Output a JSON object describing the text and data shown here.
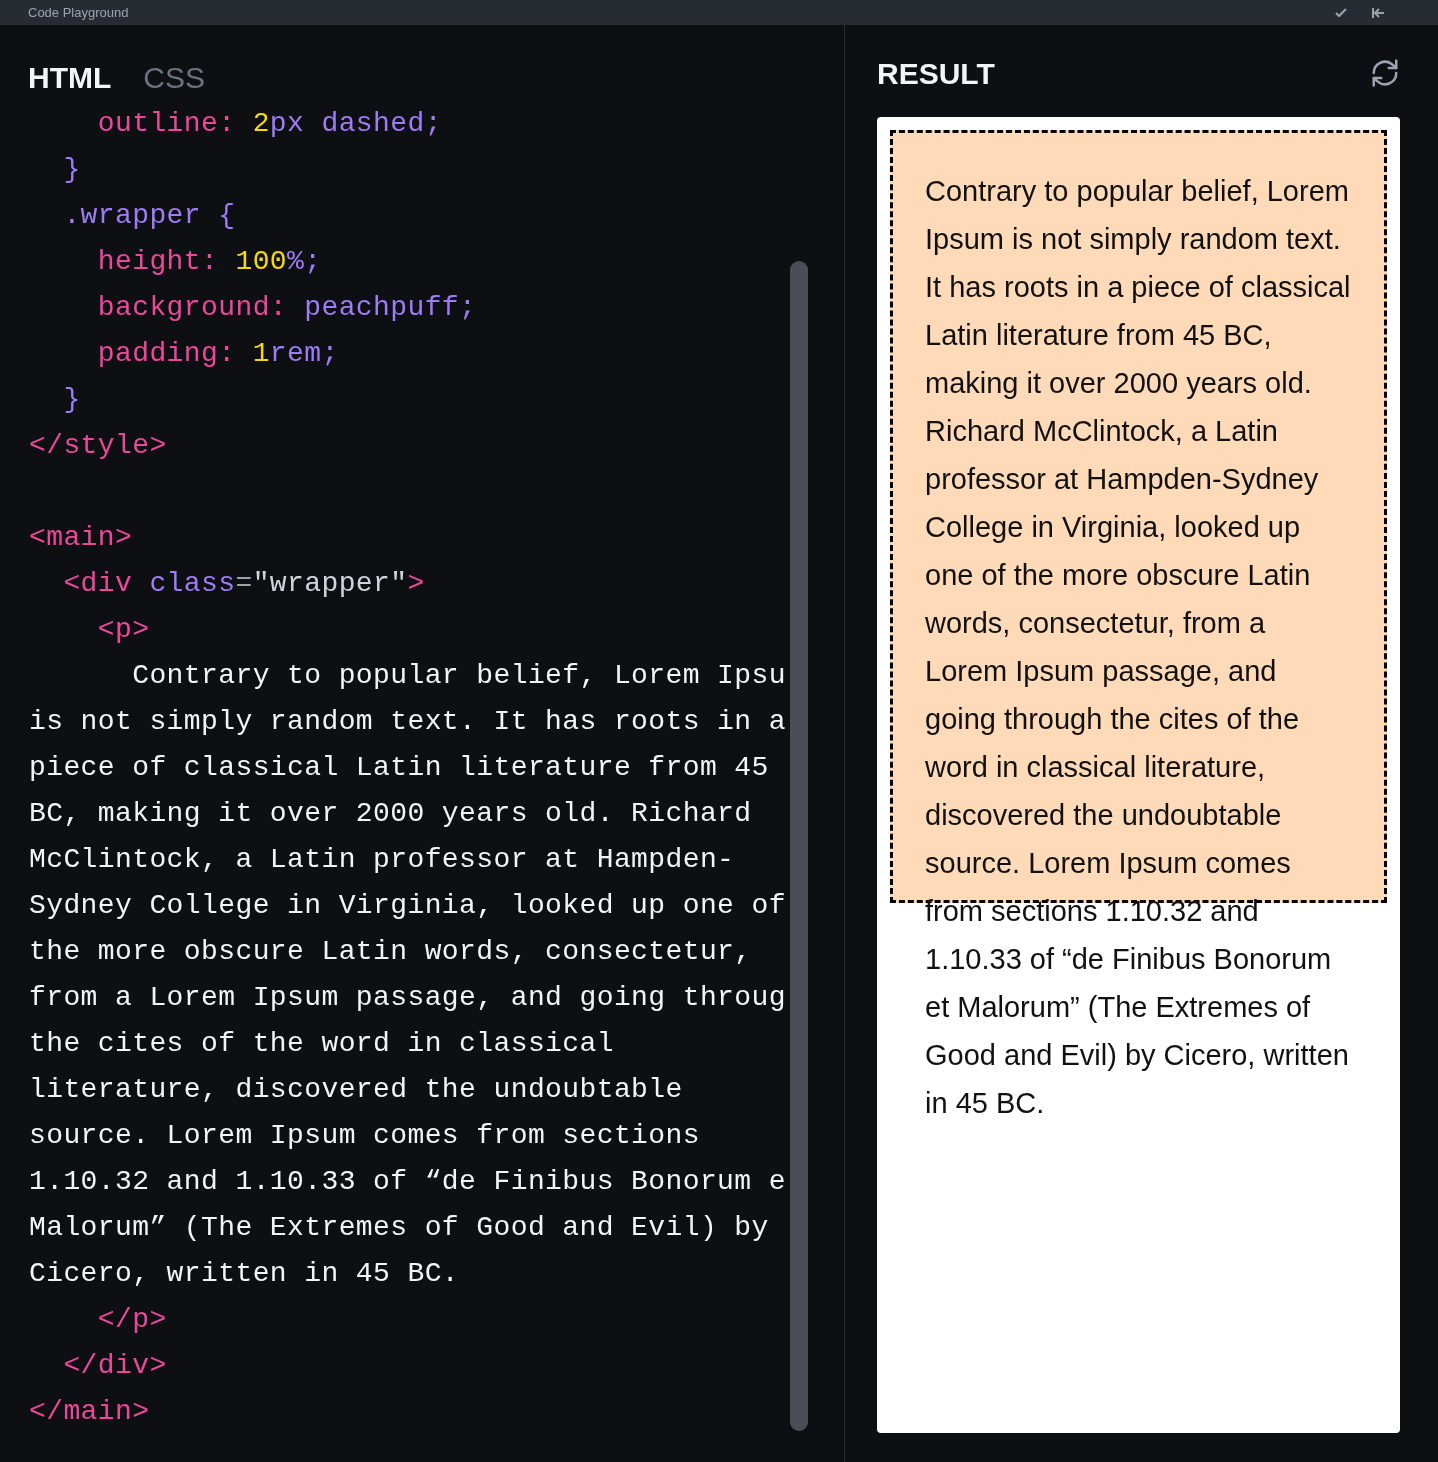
{
  "window": {
    "title": "Code Playground"
  },
  "editor": {
    "tabs": [
      {
        "label": "HTML",
        "selected": true
      },
      {
        "label": "CSS",
        "selected": false
      }
    ],
    "lines": [
      {
        "kind": "code",
        "tokens": [
          {
            "kind": "prop",
            "text": "    outline:"
          },
          {
            "kind": "num",
            "text": " 2"
          },
          {
            "kind": "value",
            "text": "px dashed;"
          }
        ]
      },
      {
        "kind": "code",
        "tokens": [
          {
            "kind": "value",
            "text": "  }"
          }
        ]
      },
      {
        "kind": "code",
        "tokens": [
          {
            "kind": "value",
            "text": "  .wrapper {"
          }
        ]
      },
      {
        "kind": "code",
        "tokens": [
          {
            "kind": "prop",
            "text": "    height:"
          },
          {
            "kind": "num",
            "text": " 100"
          },
          {
            "kind": "value",
            "text": "%;"
          }
        ]
      },
      {
        "kind": "code",
        "tokens": [
          {
            "kind": "prop",
            "text": "    background:"
          },
          {
            "kind": "value",
            "text": " peachpuff;"
          }
        ]
      },
      {
        "kind": "code",
        "tokens": [
          {
            "kind": "prop",
            "text": "    padding:"
          },
          {
            "kind": "num",
            "text": " 1"
          },
          {
            "kind": "value",
            "text": "rem;"
          }
        ]
      },
      {
        "kind": "code",
        "tokens": [
          {
            "kind": "value",
            "text": "  }"
          }
        ]
      },
      {
        "kind": "code",
        "tokens": [
          {
            "kind": "tag",
            "text": "</style>"
          }
        ]
      },
      {
        "kind": "blank"
      },
      {
        "kind": "code",
        "tokens": [
          {
            "kind": "tag",
            "text": "<main>"
          }
        ]
      },
      {
        "kind": "code",
        "tokens": [
          {
            "kind": "tag",
            "text": "  <div"
          },
          {
            "kind": "value",
            "text": " class"
          },
          {
            "kind": "punct",
            "text": "="
          },
          {
            "kind": "string",
            "text": "\"wrapper\""
          },
          {
            "kind": "tag",
            "text": ">"
          }
        ]
      },
      {
        "kind": "code",
        "tokens": [
          {
            "kind": "tag",
            "text": "    <p>"
          }
        ]
      },
      {
        "kind": "code",
        "tokens": [
          {
            "kind": "text",
            "text": "      Contrary to popular belief, Lorem Ipsu"
          }
        ]
      },
      {
        "kind": "code",
        "tokens": [
          {
            "kind": "text",
            "text": "is not simply random text. It has roots in a"
          }
        ]
      },
      {
        "kind": "code",
        "tokens": [
          {
            "kind": "text",
            "text": "piece of classical Latin literature from 45"
          }
        ]
      },
      {
        "kind": "code",
        "tokens": [
          {
            "kind": "text",
            "text": "BC, making it over 2000 years old. Richard"
          }
        ]
      },
      {
        "kind": "code",
        "tokens": [
          {
            "kind": "text",
            "text": "McClintock, a Latin professor at Hampden-"
          }
        ]
      },
      {
        "kind": "code",
        "tokens": [
          {
            "kind": "text",
            "text": "Sydney College in Virginia, looked up one of"
          }
        ]
      },
      {
        "kind": "code",
        "tokens": [
          {
            "kind": "text",
            "text": "the more obscure Latin words, consectetur,"
          }
        ]
      },
      {
        "kind": "code",
        "tokens": [
          {
            "kind": "text",
            "text": "from a Lorem Ipsum passage, and going throug"
          }
        ]
      },
      {
        "kind": "code",
        "tokens": [
          {
            "kind": "text",
            "text": "the cites of the word in classical"
          }
        ]
      },
      {
        "kind": "code",
        "tokens": [
          {
            "kind": "text",
            "text": "literature, discovered the undoubtable"
          }
        ]
      },
      {
        "kind": "code",
        "tokens": [
          {
            "kind": "text",
            "text": "source. Lorem Ipsum comes from sections"
          }
        ]
      },
      {
        "kind": "code",
        "tokens": [
          {
            "kind": "text",
            "text": "1.10.32 and 1.10.33 of “de Finibus Bonorum e"
          }
        ]
      },
      {
        "kind": "code",
        "tokens": [
          {
            "kind": "text",
            "text": "Malorum” (The Extremes of Good and Evil) by"
          }
        ]
      },
      {
        "kind": "code",
        "tokens": [
          {
            "kind": "text",
            "text": "Cicero, written in 45 BC."
          }
        ]
      },
      {
        "kind": "code",
        "tokens": [
          {
            "kind": "tag",
            "text": "    </p>"
          }
        ]
      },
      {
        "kind": "code",
        "tokens": [
          {
            "kind": "tag",
            "text": "  </div>"
          }
        ]
      },
      {
        "kind": "code",
        "tokens": [
          {
            "kind": "tag",
            "text": "</main>"
          }
        ]
      }
    ]
  },
  "result": {
    "title": "RESULT",
    "paragraph": "Contrary to popular belief, Lorem Ipsum is not simply random text. It has roots in a piece of classical Latin literature from 45 BC, making it over 2000 years old. Richard McClintock, a Latin professor at Hampden-Sydney College in Virginia, looked up one of the more obscure Latin words, consectetur, from a Lorem Ipsum passage, and going through the cites of the word in classical literature, discovered the undoubtable source. Lorem Ipsum comes from sections 1.10.32 and 1.10.33 of “de Finibus Bonorum et Malorum” (The Extremes of Good and Evil) by Cicero, written in 45 BC."
  }
}
